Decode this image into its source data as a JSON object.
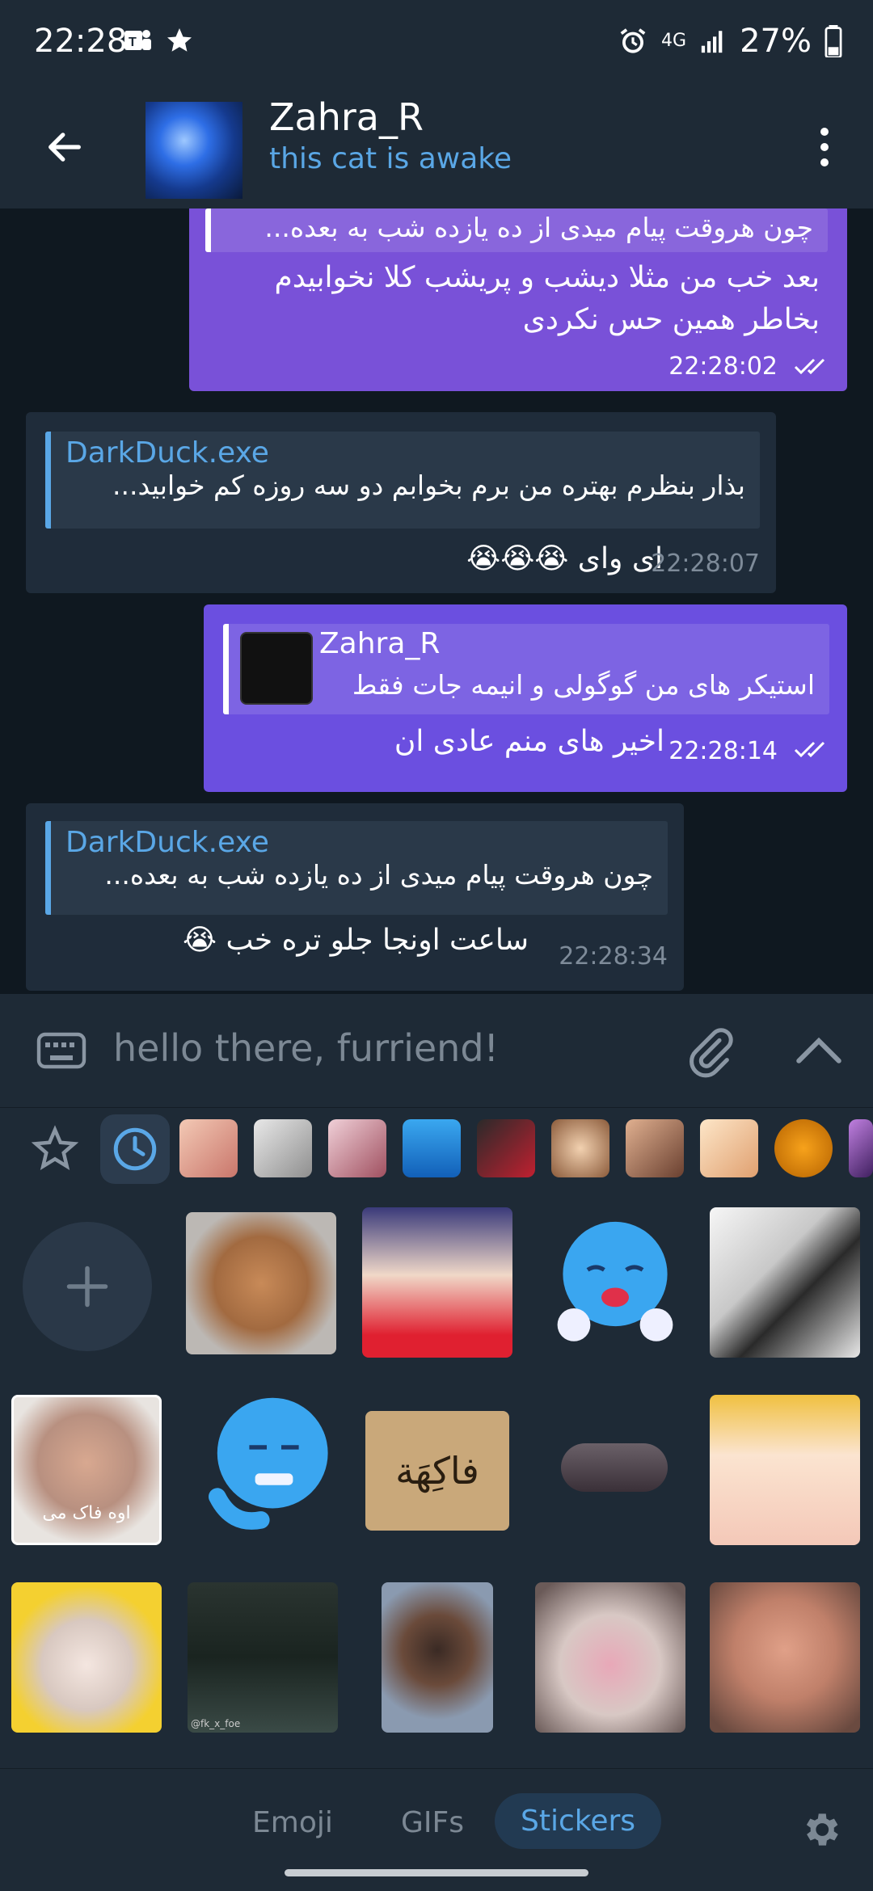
{
  "status_bar": {
    "time": "22:28",
    "battery": "27%",
    "network": "4G"
  },
  "header": {
    "contact_name": "Zahra_R",
    "contact_status": "this cat is awake"
  },
  "messages": [
    {
      "reply_text": "چون هروقت پیام میدی از ده یازده شب به بعده...",
      "line1": "بعد خب من مثلا دیشب و پریشب کلا نخوابیدم",
      "line2": "بخاطر همین حس نکردی",
      "time": "22:28:02"
    },
    {
      "reply_name": "DarkDuck.exe",
      "reply_text": "بذار  بنظرم بهتره من برم بخوابم دو سه روزه کم خوابید...",
      "text": "ای وای 😭😭😭",
      "time": "22:28:07"
    },
    {
      "reply_name": "Zahra_R",
      "reply_text": "استیکر های من گوگولی و انیمه جات فقط",
      "text": "اخیر های منم عادی ان",
      "time": "22:28:14"
    },
    {
      "reply_name": "DarkDuck.exe",
      "reply_text": "چون هروقت پیام میدی از ده یازده شب به بعده...",
      "text": "ساعت اونجا جلو تره خب 😭",
      "time": "22:28:34"
    }
  ],
  "input": {
    "placeholder": "hello there, furriend!"
  },
  "stickers": {
    "caption_text": "اوه فاک می",
    "sign_text": "فاکِهَة",
    "watermark": "@fk_x_foe"
  },
  "bottom_tabs": {
    "emoji": "Emoji",
    "gifs": "GIFs",
    "stickers": "Stickers"
  },
  "colors": {
    "accent": "#5aa7e6",
    "outgoing_bubble": "#7951d8",
    "incoming_bubble": "#1f2c3a",
    "background": "#17212b"
  }
}
